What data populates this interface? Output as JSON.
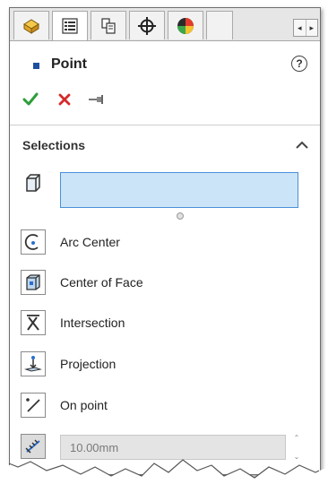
{
  "tabs": [
    {
      "name": "featuremanager",
      "active": false
    },
    {
      "name": "propertymanager",
      "active": true
    },
    {
      "name": "configurationmanager",
      "active": false
    },
    {
      "name": "dimxpertmanager",
      "active": false
    },
    {
      "name": "display-manager",
      "active": false
    }
  ],
  "header": {
    "title": "Point",
    "help_icon": "?"
  },
  "actions": {
    "ok": "check-icon",
    "cancel": "x-icon",
    "pin": "pushpin-icon"
  },
  "selections": {
    "title": "Selections",
    "input_value": ""
  },
  "options": [
    {
      "label": "Arc Center",
      "icon": "arc-center-icon"
    },
    {
      "label": "Center of Face",
      "icon": "center-of-face-icon"
    },
    {
      "label": "Intersection",
      "icon": "intersection-icon"
    },
    {
      "label": "Projection",
      "icon": "projection-icon"
    },
    {
      "label": "On point",
      "icon": "on-point-icon"
    }
  ],
  "distance": {
    "value": "10.00mm"
  },
  "colors": {
    "accent": "#1e4f9e",
    "selection_box": "#cce4f7",
    "ok_green": "#2e9e3a",
    "cancel_red": "#d42a2a"
  }
}
